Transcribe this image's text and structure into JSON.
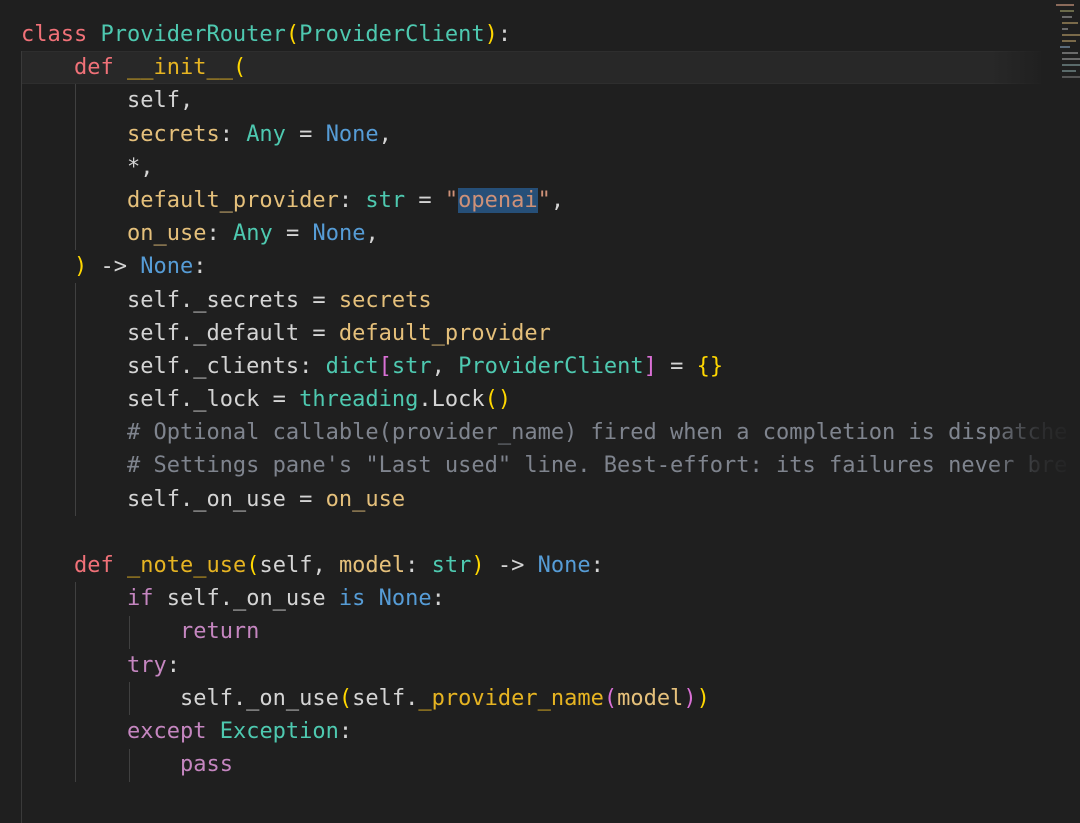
{
  "editor": {
    "language": "python",
    "colors": {
      "background": "#1f1f1f",
      "keyword": "#f07178",
      "control_keyword": "#c586c0",
      "class_name": "#4ec9b0",
      "function_name": "#dcdcaa",
      "constant": "#569cd6",
      "string": "#ce9178",
      "comment": "#7f848e",
      "parameter": "#e5c07b",
      "selection": "#264f78"
    },
    "lines": [
      [
        {
          "t": "class",
          "c": "kw"
        },
        {
          "t": " ",
          "c": "op"
        },
        {
          "t": "ProviderRouter",
          "c": "cls"
        },
        {
          "t": "(",
          "c": "b1"
        },
        {
          "t": "ProviderClient",
          "c": "cls"
        },
        {
          "t": ")",
          "c": "b1"
        },
        {
          "t": ":",
          "c": "op"
        }
      ],
      [
        {
          "t": "    ",
          "c": "op"
        },
        {
          "t": "def",
          "c": "kw"
        },
        {
          "t": " ",
          "c": "op"
        },
        {
          "t": "__init__",
          "c": "fname"
        },
        {
          "t": "(",
          "c": "b1"
        }
      ],
      [
        {
          "t": "        ",
          "c": "op"
        },
        {
          "t": "self",
          "c": "self"
        },
        {
          "t": ",",
          "c": "op"
        }
      ],
      [
        {
          "t": "        ",
          "c": "op"
        },
        {
          "t": "secrets",
          "c": "param"
        },
        {
          "t": ": ",
          "c": "op"
        },
        {
          "t": "Any",
          "c": "typ"
        },
        {
          "t": " = ",
          "c": "op"
        },
        {
          "t": "None",
          "c": "const"
        },
        {
          "t": ",",
          "c": "op"
        }
      ],
      [
        {
          "t": "        ",
          "c": "op"
        },
        {
          "t": "*",
          "c": "op"
        },
        {
          "t": ",",
          "c": "op"
        }
      ],
      [
        {
          "t": "        ",
          "c": "op"
        },
        {
          "t": "default_provider",
          "c": "param"
        },
        {
          "t": ": ",
          "c": "op"
        },
        {
          "t": "str",
          "c": "typ"
        },
        {
          "t": " = ",
          "c": "op"
        },
        {
          "t": "\"",
          "c": "str"
        },
        {
          "t": "openai",
          "c": "str hl"
        },
        {
          "t": "\"",
          "c": "str"
        },
        {
          "t": ",",
          "c": "op"
        }
      ],
      [
        {
          "t": "        ",
          "c": "op"
        },
        {
          "t": "on_use",
          "c": "param"
        },
        {
          "t": ": ",
          "c": "op"
        },
        {
          "t": "Any",
          "c": "typ"
        },
        {
          "t": " = ",
          "c": "op"
        },
        {
          "t": "None",
          "c": "const"
        },
        {
          "t": ",",
          "c": "op"
        }
      ],
      [
        {
          "t": "    ",
          "c": "op"
        },
        {
          "t": ")",
          "c": "b1"
        },
        {
          "t": " -> ",
          "c": "op"
        },
        {
          "t": "None",
          "c": "const"
        },
        {
          "t": ":",
          "c": "op"
        }
      ],
      [
        {
          "t": "        ",
          "c": "op"
        },
        {
          "t": "self",
          "c": "self"
        },
        {
          "t": "._secrets = ",
          "c": "op"
        },
        {
          "t": "secrets",
          "c": "param"
        }
      ],
      [
        {
          "t": "        ",
          "c": "op"
        },
        {
          "t": "self",
          "c": "self"
        },
        {
          "t": "._default = ",
          "c": "op"
        },
        {
          "t": "default_provider",
          "c": "param"
        }
      ],
      [
        {
          "t": "        ",
          "c": "op"
        },
        {
          "t": "self",
          "c": "self"
        },
        {
          "t": "._clients: ",
          "c": "op"
        },
        {
          "t": "dict",
          "c": "typ"
        },
        {
          "t": "[",
          "c": "b2"
        },
        {
          "t": "str",
          "c": "typ"
        },
        {
          "t": ", ",
          "c": "op"
        },
        {
          "t": "ProviderClient",
          "c": "cls"
        },
        {
          "t": "]",
          "c": "b2"
        },
        {
          "t": " = ",
          "c": "op"
        },
        {
          "t": "{}",
          "c": "b1"
        }
      ],
      [
        {
          "t": "        ",
          "c": "op"
        },
        {
          "t": "self",
          "c": "self"
        },
        {
          "t": "._lock = ",
          "c": "op"
        },
        {
          "t": "threading",
          "c": "cls"
        },
        {
          "t": ".Lock",
          "c": "op"
        },
        {
          "t": "()",
          "c": "b1"
        }
      ],
      [
        {
          "t": "        ",
          "c": "op"
        },
        {
          "t": "# Optional callable(provider_name) fired when a completion is dispatche",
          "c": "cm"
        }
      ],
      [
        {
          "t": "        ",
          "c": "op"
        },
        {
          "t": "# Settings pane's \"Last used\" line. Best-effort: its failures never bre",
          "c": "cm"
        }
      ],
      [
        {
          "t": "        ",
          "c": "op"
        },
        {
          "t": "self",
          "c": "self"
        },
        {
          "t": "._on_use = ",
          "c": "op"
        },
        {
          "t": "on_use",
          "c": "param"
        }
      ],
      [
        {
          "t": "",
          "c": "op"
        }
      ],
      [
        {
          "t": "    ",
          "c": "op"
        },
        {
          "t": "def",
          "c": "kw"
        },
        {
          "t": " ",
          "c": "op"
        },
        {
          "t": "_note_use",
          "c": "fname"
        },
        {
          "t": "(",
          "c": "b1"
        },
        {
          "t": "self",
          "c": "self"
        },
        {
          "t": ", ",
          "c": "op"
        },
        {
          "t": "model",
          "c": "param"
        },
        {
          "t": ": ",
          "c": "op"
        },
        {
          "t": "str",
          "c": "typ"
        },
        {
          "t": ")",
          "c": "b1"
        },
        {
          "t": " -> ",
          "c": "op"
        },
        {
          "t": "None",
          "c": "const"
        },
        {
          "t": ":",
          "c": "op"
        }
      ],
      [
        {
          "t": "        ",
          "c": "op"
        },
        {
          "t": "if",
          "c": "kw2"
        },
        {
          "t": " ",
          "c": "op"
        },
        {
          "t": "self",
          "c": "self"
        },
        {
          "t": "._on_use ",
          "c": "op"
        },
        {
          "t": "is",
          "c": "const"
        },
        {
          "t": " ",
          "c": "op"
        },
        {
          "t": "None",
          "c": "const"
        },
        {
          "t": ":",
          "c": "op"
        }
      ],
      [
        {
          "t": "            ",
          "c": "op"
        },
        {
          "t": "return",
          "c": "kw2"
        }
      ],
      [
        {
          "t": "        ",
          "c": "op"
        },
        {
          "t": "try",
          "c": "kw2"
        },
        {
          "t": ":",
          "c": "op"
        }
      ],
      [
        {
          "t": "            ",
          "c": "op"
        },
        {
          "t": "self",
          "c": "self"
        },
        {
          "t": "._on_use",
          "c": "op"
        },
        {
          "t": "(",
          "c": "b1"
        },
        {
          "t": "self",
          "c": "self"
        },
        {
          "t": ".",
          "c": "op"
        },
        {
          "t": "_provider_name",
          "c": "fname"
        },
        {
          "t": "(",
          "c": "b2"
        },
        {
          "t": "model",
          "c": "param"
        },
        {
          "t": ")",
          "c": "b2"
        },
        {
          "t": ")",
          "c": "b1"
        }
      ],
      [
        {
          "t": "        ",
          "c": "op"
        },
        {
          "t": "except",
          "c": "kw2"
        },
        {
          "t": " ",
          "c": "op"
        },
        {
          "t": "Exception",
          "c": "cls"
        },
        {
          "t": ":",
          "c": "op"
        }
      ],
      [
        {
          "t": "            ",
          "c": "op"
        },
        {
          "t": "pass",
          "c": "kw2"
        }
      ]
    ]
  }
}
